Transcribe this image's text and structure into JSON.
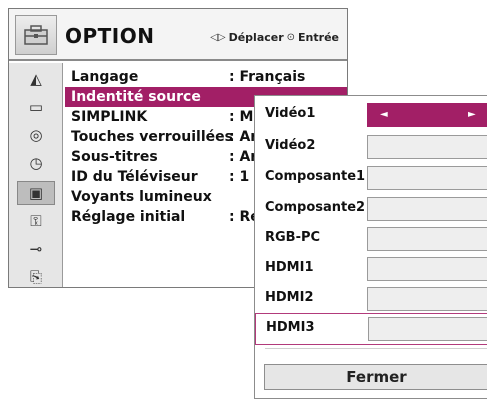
{
  "header": {
    "title": "OPTION",
    "hint_move": "Déplacer",
    "hint_enter": "Entrée",
    "icon": "option-toolbox-icon"
  },
  "strip_icons": [
    {
      "name": "picture-icon",
      "glyph": "◭"
    },
    {
      "name": "screen-icon",
      "glyph": "▭"
    },
    {
      "name": "audio-icon",
      "glyph": "◎"
    },
    {
      "name": "time-icon",
      "glyph": "◷"
    },
    {
      "name": "option-icon",
      "glyph": "▣",
      "active": true
    },
    {
      "name": "lock-icon",
      "glyph": "🔒"
    },
    {
      "name": "input-icon",
      "glyph": "⊸"
    },
    {
      "name": "usb-icon",
      "glyph": "⎘"
    }
  ],
  "menu": [
    {
      "label": "Langage",
      "value": ": Français"
    },
    {
      "label": "Indentité source",
      "value": "",
      "selected": true
    },
    {
      "label": "SIMPLINK",
      "value": ": Ma"
    },
    {
      "label": "Touches verrouillées",
      "value": ": Ar"
    },
    {
      "label": "Sous-titres",
      "value": ": Ar"
    },
    {
      "label": "ID du Téléviseur",
      "value": ": 1"
    },
    {
      "label": "Voyants lumineux",
      "value": ""
    },
    {
      "label": "Réglage initial",
      "value": ": Ré"
    }
  ],
  "popup": {
    "rows": [
      {
        "label": "Vidéo1",
        "active": true,
        "left_arrow": "◄",
        "right_arrow": "►"
      },
      {
        "label": "Vidéo2"
      },
      {
        "label": "Composante1"
      },
      {
        "label": "Composante2"
      },
      {
        "label": "RGB-PC"
      },
      {
        "label": "HDMI1"
      },
      {
        "label": "HDMI2"
      },
      {
        "label": "HDMI3",
        "highlight": true
      }
    ],
    "close_label": "Fermer"
  },
  "colors": {
    "accent": "#a21f66",
    "panel": "#e6e6e6"
  }
}
